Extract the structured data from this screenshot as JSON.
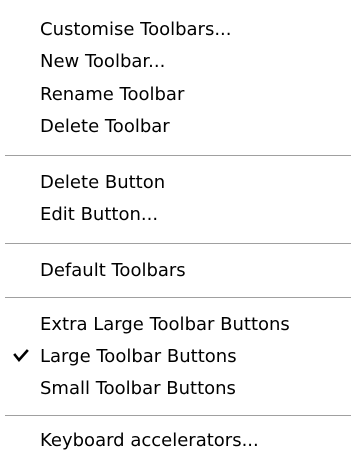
{
  "menu": {
    "items": [
      {
        "label": "Customise Toolbars..."
      },
      {
        "label": "New Toolbar..."
      },
      {
        "label": "Rename Toolbar"
      },
      {
        "label": "Delete Toolbar"
      },
      {
        "label": "Delete Button"
      },
      {
        "label": "Edit Button..."
      },
      {
        "label": "Default Toolbars"
      },
      {
        "label": "Extra Large Toolbar Buttons"
      },
      {
        "label": "Large Toolbar Buttons",
        "checked": true
      },
      {
        "label": "Small Toolbar Buttons"
      },
      {
        "label": "Keyboard accelerators..."
      }
    ],
    "check_icon": "checkmark-icon"
  }
}
